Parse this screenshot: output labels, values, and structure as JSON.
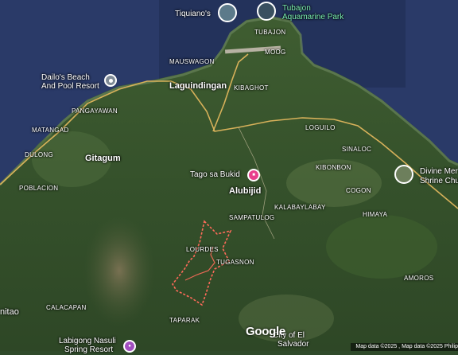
{
  "labels": {
    "tiquianos": "Tiquiano's",
    "tubajon_park_line1": "Tubajon",
    "tubajon_park_line2": "Aquamarine Park",
    "tubajon": "TUBAJON",
    "moog": "MOOG",
    "mauswagon": "MAUSWAGON",
    "dailo_line1": "Dailo's Beach",
    "dailo_line2": "And Pool Resort",
    "laguindingan": "Laguindingan",
    "kibaghot": "KIBAGHOT",
    "pangayawan": "PANGAYAWAN",
    "matangad": "MATANGAD",
    "loguilo": "LOGUILO",
    "sinaloc": "SINALOC",
    "dulong": "DULONG",
    "gitagum": "Gitagum",
    "kibonbon": "KIBONBON",
    "divine_line1": "Divine Mer",
    "divine_line2": "Shrine Chu",
    "tago": "Tago sa Bukid",
    "poblacion": "POBLACION",
    "cogon": "COGON",
    "alubijid": "Alubijid",
    "kalabaylabay": "KALABAYLABAY",
    "sampatulog": "SAMPATULOG",
    "himaya": "HIMAYA",
    "lourdes": "LOURDES",
    "tugasnon": "TUGASNON",
    "amoros": "AMOROS",
    "initao": "nitao",
    "calacapan": "CALACAPAN",
    "taparak": "TAPARAK",
    "labigong_line1": "Labigong Nasuli",
    "labigong_line2": "Spring Resort",
    "el_salvador_line1": "City of El",
    "el_salvador_line2": "Salvador"
  },
  "branding": {
    "google": "Google",
    "attribution": "Map data ©2025 , Map data ©2025   Philip"
  },
  "colors": {
    "sea": "#2a3a68",
    "land": "#3b5a30",
    "road": "#d7b15a",
    "boundary": "#ff6b5a",
    "pink_pin": "#e83e8c",
    "purple_pin": "#a24fc0"
  }
}
